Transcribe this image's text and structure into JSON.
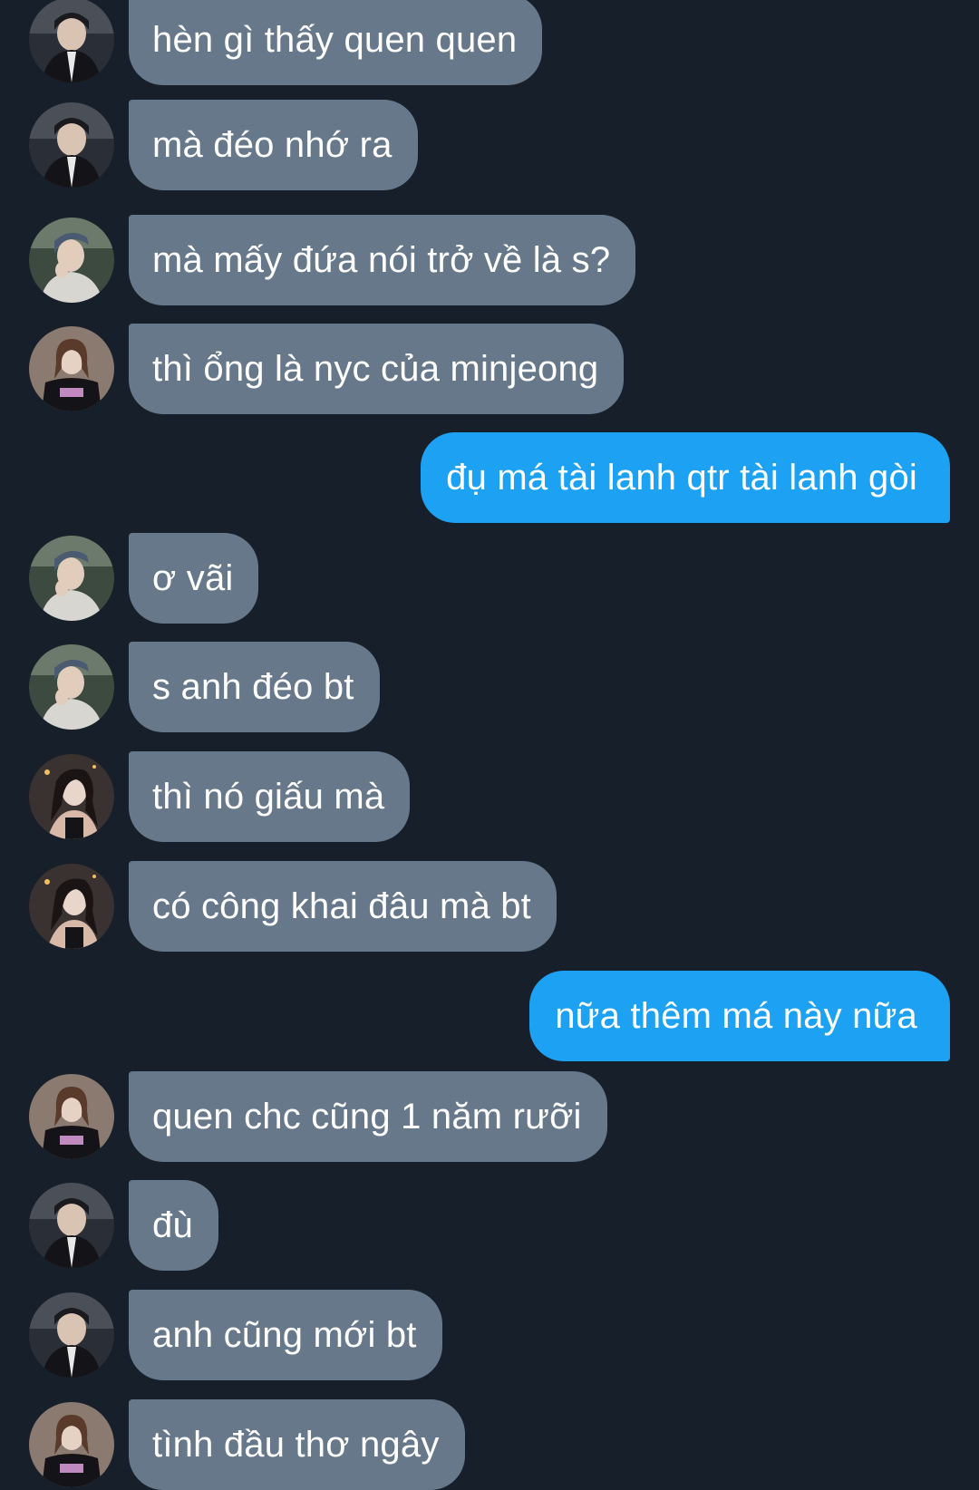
{
  "colors": {
    "background": "#17202a",
    "incoming_bubble": "#66788a",
    "outgoing_bubble": "#1da1f2",
    "text": "#ffffff"
  },
  "messages": [
    {
      "direction": "in",
      "avatar": "avatar-boy-dark",
      "text": "hèn gì thấy quen quen"
    },
    {
      "direction": "in",
      "avatar": "avatar-boy-dark",
      "text": "mà đéo nhớ ra"
    },
    {
      "direction": "in",
      "avatar": "avatar-boy-light",
      "text": "mà mấy đứa nói trở về là s?"
    },
    {
      "direction": "in",
      "avatar": "avatar-girl-shirt",
      "text": "thì ổng là nyc của minjeong"
    },
    {
      "direction": "out",
      "avatar": null,
      "text": "đụ má tài lanh qtr tài lanh gòi"
    },
    {
      "direction": "in",
      "avatar": "avatar-boy-light",
      "text": "ơ vãi"
    },
    {
      "direction": "in",
      "avatar": "avatar-boy-light",
      "text": "s anh đéo bt"
    },
    {
      "direction": "in",
      "avatar": "avatar-girl-hair",
      "text": "thì nó giấu mà"
    },
    {
      "direction": "in",
      "avatar": "avatar-girl-hair",
      "text": "có công khai đâu mà bt"
    },
    {
      "direction": "out",
      "avatar": null,
      "text": "nữa thêm má này nữa"
    },
    {
      "direction": "in",
      "avatar": "avatar-girl-shirt",
      "text": "quen chc cũng 1 năm rưỡi"
    },
    {
      "direction": "in",
      "avatar": "avatar-boy-dark",
      "text": "đù"
    },
    {
      "direction": "in",
      "avatar": "avatar-boy-dark",
      "text": "anh cũng mới bt"
    },
    {
      "direction": "in",
      "avatar": "avatar-girl-shirt",
      "text": "tình đầu thơ ngây"
    }
  ]
}
